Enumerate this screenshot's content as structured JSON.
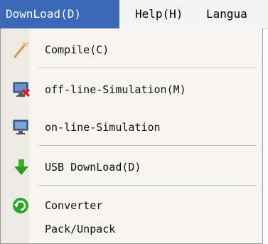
{
  "menubar": {
    "items": [
      {
        "label": "DownLoad(D)"
      },
      {
        "label": "Help(H)"
      },
      {
        "label": "Langua"
      }
    ]
  },
  "dropdown": {
    "items": [
      {
        "label": "Compile(C)",
        "icon": "compile-wand-icon"
      },
      {
        "label": "off-line-Simulation(M)",
        "icon": "offline-monitor-icon"
      },
      {
        "label": "on-line-Simulation",
        "icon": "online-monitor-icon"
      },
      {
        "label": "USB DownLoad(D)",
        "icon": "green-down-arrow-icon"
      },
      {
        "label": "Converter",
        "icon": "converter-refresh-icon"
      },
      {
        "label": "Pack/Unpack",
        "icon": ""
      }
    ]
  },
  "colors": {
    "menu_highlight": "#3a68b6",
    "dropdown_background": "#f6f5f2"
  }
}
